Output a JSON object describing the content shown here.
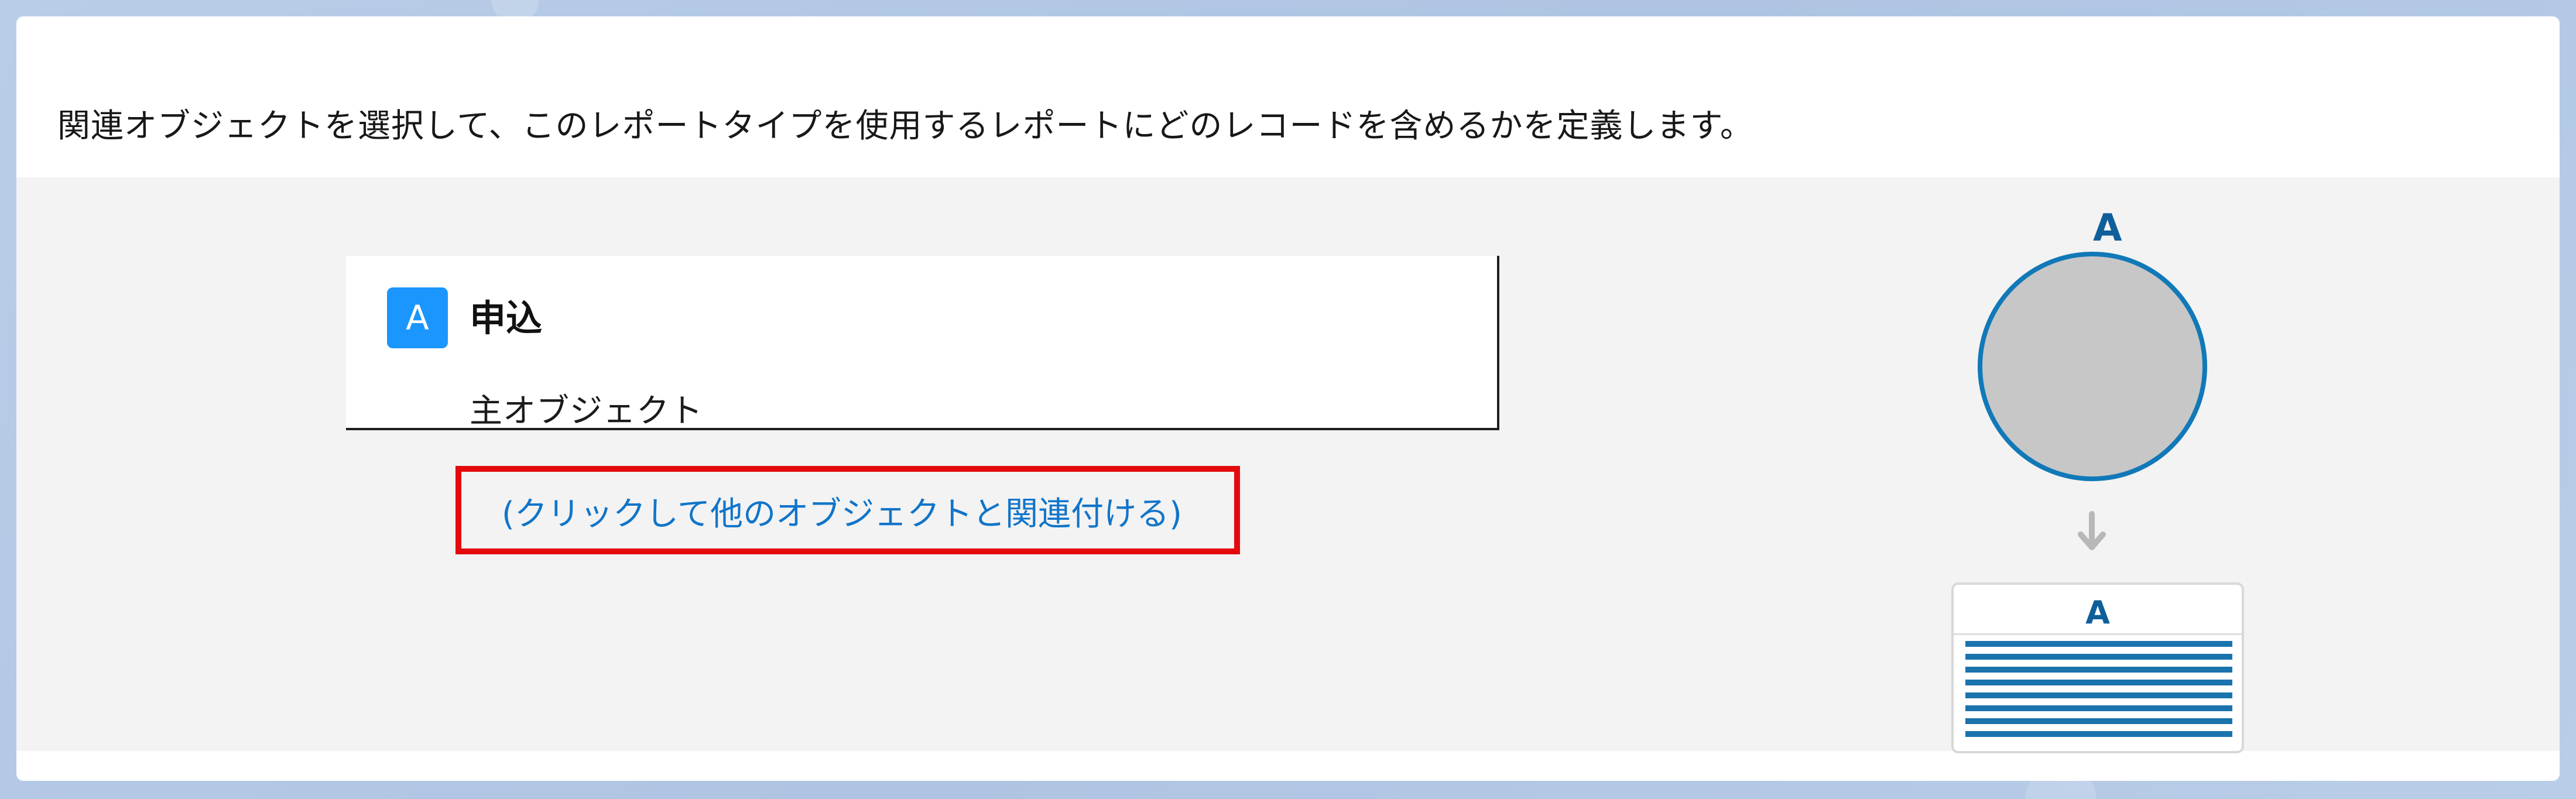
{
  "instruction_text": "関連オブジェクトを選択して、このレポートタイプを使用するレポートにどのレコードを含めるかを定義します。",
  "object": {
    "badge": "A",
    "title": "申込",
    "subtitle": "主オブジェクト"
  },
  "relate_link": {
    "label": "(クリックして他のオブジェクトと関連付ける)"
  },
  "diagram": {
    "top_label": "A",
    "table_label": "A",
    "icon_names": [
      "circle-icon",
      "arrow-down-icon",
      "table-icon"
    ]
  },
  "colors": {
    "badge_bg": "#1b96ff",
    "link": "#1175c9",
    "highlight": "#e4090d",
    "diagram_blue": "#1179b8"
  }
}
